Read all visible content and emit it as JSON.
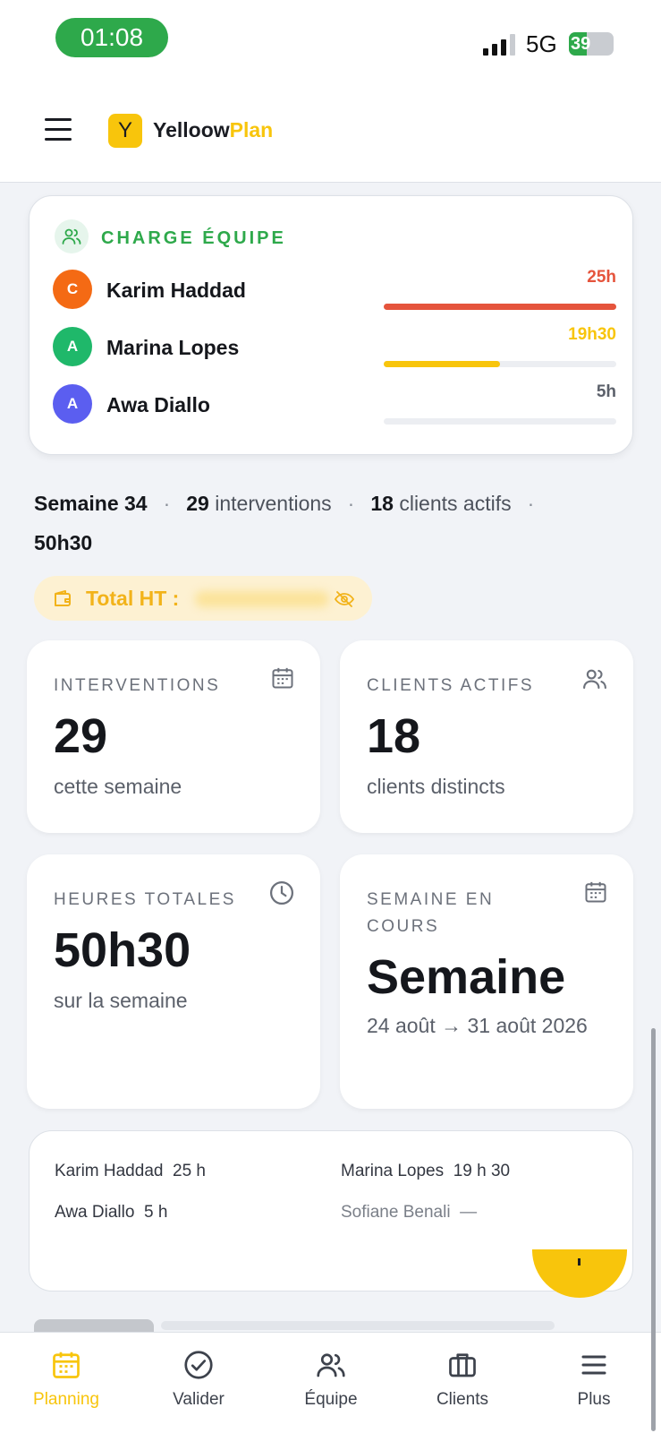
{
  "status_bar": {
    "time": "01:08",
    "network": "5G",
    "battery": "39"
  },
  "header": {
    "logo_letter": "Y",
    "brand_part1": "Yelloow",
    "brand_part2": "Plan"
  },
  "charge_equipe": {
    "title": "CHARGE ÉQUIPE",
    "members": [
      {
        "initial": "C",
        "name": "Karim Haddad",
        "hours": "25h",
        "load": 1.0,
        "color": "#f46a14",
        "bar_color": "#e5543c"
      },
      {
        "initial": "A",
        "name": "Marina Lopes",
        "hours": "19h30",
        "load": 0.5,
        "color": "#1fb86a",
        "bar_color": "#f8c50c"
      },
      {
        "initial": "A",
        "name": "Awa Diallo",
        "hours": "5h",
        "load": 0.0,
        "color": "#5b5ef0",
        "bar_color": "#f8c50c"
      }
    ]
  },
  "summary": {
    "week": "Semaine 34",
    "interventions_count": "29",
    "interventions_label": "interventions",
    "clients_count": "18",
    "clients_label": "clients actifs",
    "total_hours": "50h30"
  },
  "total_ht": {
    "label": "Total HT :"
  },
  "stats": {
    "interventions": {
      "label": "INTERVENTIONS",
      "value": "29",
      "sub": "cette semaine"
    },
    "clients": {
      "label": "CLIENTS ACTIFS",
      "value": "18",
      "sub": "clients distincts"
    },
    "hours": {
      "label": "HEURES TOTALES",
      "value": "50h30",
      "sub": "sur la semaine"
    },
    "week": {
      "label": "SEMAINE EN COURS",
      "value": "Semaine",
      "sub": "24 août → 31 août 2026"
    }
  },
  "hours_list": [
    {
      "name": "Karim Haddad",
      "hours": "25 h"
    },
    {
      "name": "Marina Lopes",
      "hours": "19 h 30"
    },
    {
      "name": "Awa Diallo",
      "hours": "5 h"
    },
    {
      "name": "Sofiane Benali",
      "hours": "—"
    }
  ],
  "nav": {
    "accent": "#f8c50c",
    "items": [
      {
        "label": "Planning",
        "icon": "calendar-icon",
        "active": true
      },
      {
        "label": "Valider",
        "icon": "check-circle-icon",
        "active": false
      },
      {
        "label": "Équipe",
        "icon": "users-icon",
        "active": false
      },
      {
        "label": "Clients",
        "icon": "briefcase-icon",
        "active": false
      },
      {
        "label": "Plus",
        "icon": "menu-icon",
        "active": false
      }
    ]
  }
}
